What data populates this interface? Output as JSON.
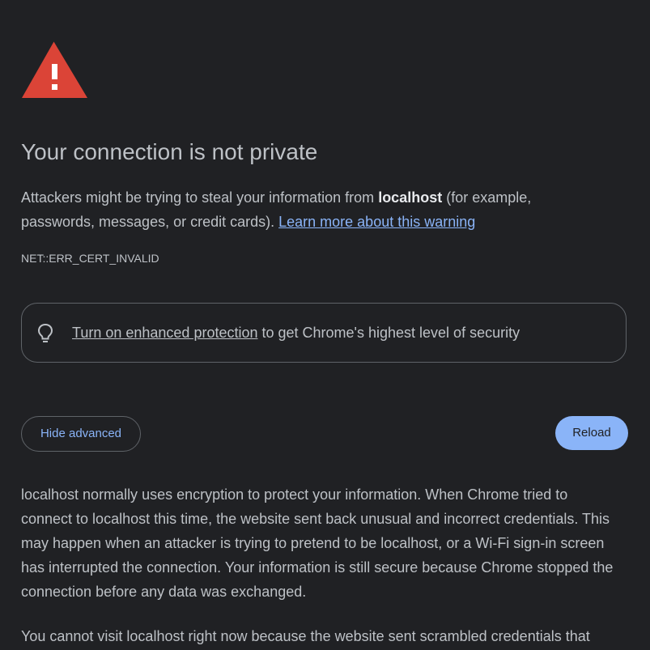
{
  "colors": {
    "background": "#202124",
    "text": "#bdc1c6",
    "link": "#8ab4f8",
    "warning_red": "#db4437",
    "border": "#5f6368"
  },
  "icons": {
    "warning": "warning-triangle-icon",
    "bulb": "lightbulb-icon"
  },
  "heading": "Your connection is not private",
  "intro": {
    "before": "Attackers might be trying to steal your information from ",
    "host": "localhost",
    "after": " (for example, passwords, messages, or credit cards). ",
    "learn_more": "Learn more about this warning"
  },
  "error_code": "NET::ERR_CERT_INVALID",
  "enhanced": {
    "link": "Turn on enhanced protection",
    "rest": " to get Chrome's highest level of security"
  },
  "buttons": {
    "hide_advanced": "Hide advanced",
    "reload": "Reload"
  },
  "details": {
    "paragraph1": "localhost normally uses encryption to protect your information. When Chrome tried to connect to localhost this time, the website sent back unusual and incorrect credentials. This may happen when an attacker is trying to pretend to be localhost, or a Wi-Fi sign-in screen has interrupted the connection. Your information is still secure because Chrome stopped the connection before any data was exchanged.",
    "paragraph2": "You cannot visit localhost right now because the website sent scrambled credentials that"
  }
}
